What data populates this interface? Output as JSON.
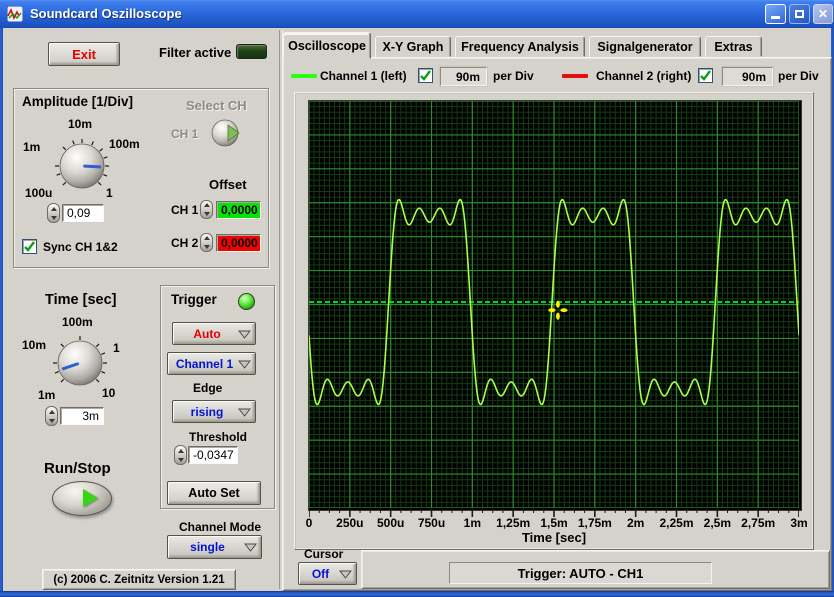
{
  "window": {
    "title": "Soundcard Oszilloscope"
  },
  "left_panel": {
    "exit_button": "Exit",
    "filter_label": "Filter active",
    "amplitude": {
      "title": "Amplitude [1/Div]",
      "dial": {
        "top": "10m",
        "left": "1m",
        "right": "100m",
        "bottom_left": "100u",
        "bottom_right": "1"
      },
      "value": "0,09",
      "sync_label": "Sync CH 1&2",
      "select_ch_label": "Select CH",
      "select_ch_value": "CH 1",
      "offset_label": "Offset",
      "offset_ch1_label": "CH 1",
      "offset_ch1_value": "0,0000",
      "offset_ch2_label": "CH 2",
      "offset_ch2_value": "0,0000",
      "offset_ch1_color": "#07e207",
      "offset_ch2_color": "#ef0303"
    },
    "time": {
      "title": "Time [sec]",
      "dial": {
        "top": "100m",
        "left": "10m",
        "right": "1",
        "bottom_left": "1m",
        "bottom_right": "10"
      },
      "value": "3m"
    },
    "trigger": {
      "title": "Trigger",
      "mode": "Auto",
      "source": "Channel 1",
      "edge_label": "Edge",
      "edge": "rising",
      "threshold_label": "Threshold",
      "threshold": "-0,0347",
      "auto_set_button": "Auto Set"
    },
    "run_stop_label": "Run/Stop",
    "channel_mode_label": "Channel Mode",
    "channel_mode": "single",
    "copyright": "(c) 2006 C. Zeitnitz Version 1.21"
  },
  "tabs": [
    {
      "label": "Oscilloscope",
      "active": true
    },
    {
      "label": "X-Y Graph",
      "active": false
    },
    {
      "label": "Frequency Analysis",
      "active": false
    },
    {
      "label": "Signalgenerator",
      "active": false
    },
    {
      "label": "Extras",
      "active": false
    }
  ],
  "scope": {
    "channel1": {
      "label": "Channel 1 (left)",
      "checked": true,
      "scale": "90m",
      "unit": "per Div",
      "color": "#2eff12"
    },
    "channel2": {
      "label": "Channel 2 (right)",
      "checked": true,
      "scale": "90m",
      "unit": "per Div",
      "color": "#e01010"
    },
    "x_label": "Time [sec]",
    "x_ticks": [
      "0",
      "250u",
      "500u",
      "750u",
      "1m",
      "1,25m",
      "1,5m",
      "1,75m",
      "2m",
      "2,25m",
      "2,5m",
      "2,75m",
      "3m"
    ],
    "cursor_label": "Cursor",
    "cursor_value": "Off",
    "status": "Trigger: AUTO - CH1",
    "waveform": {
      "type": "line",
      "description": "band-limited 1 kHz square wave on channel 1, falling edge at t=0",
      "harmonics": [
        1,
        3,
        5,
        7
      ],
      "period_s": 0.001,
      "span_s": 0.003,
      "amplitude_divisions": 2.6,
      "color": "#a8ff4a"
    },
    "grid": {
      "major_x_divisions": 12,
      "major_y_divisions": 12,
      "minor_per_major_x": 8,
      "minor_per_major_y": 6,
      "minor_color": "#143c14",
      "major_color": "#2e8b2e",
      "background": "#000000",
      "zero_line_color": "#00d42a"
    },
    "cursor_marker": {
      "x_frac": 0.508,
      "y_frac": 0.514,
      "color": "#ffee00"
    }
  }
}
